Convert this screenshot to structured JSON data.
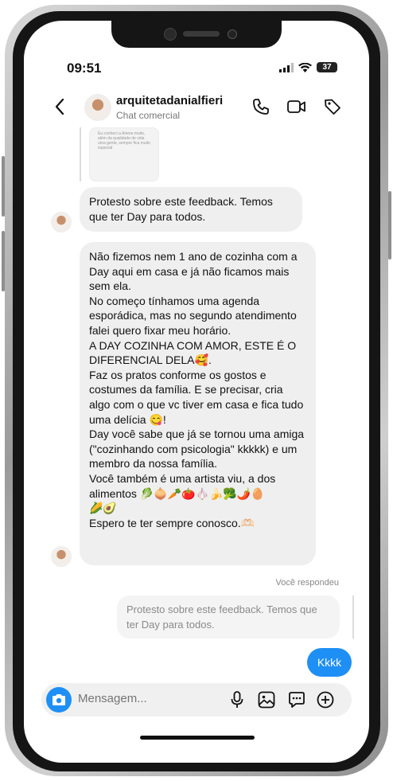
{
  "status": {
    "time": "09:51",
    "battery": "37"
  },
  "header": {
    "username": "arquitetadanialfieri",
    "subtitle": "Chat comercial"
  },
  "quoted_thumb_text": "Eu conheci a Ariene muito, além da qualidade de vida uma gente, sempre fica muito especial",
  "messages": [
    {
      "text": "Protesto sobre este feedback. Temos que ter Day para todos."
    },
    {
      "text": "Não fizemos nem 1 ano de cozinha com a Day aqui em casa e já não ficamos mais sem ela.\nNo começo tínhamos uma agenda esporádica, mas no segundo atendimento falei quero fixar meu horário.\nA DAY COZINHA COM AMOR, ESTE É O DIFERENCIAL DELA🥰.\nFaz os pratos conforme os gostos e costumes da família. E se precisar, cria algo com o que vc tiver em casa e fica tudo uma delícia 😋!\nDay você sabe que já se tornou uma amiga (\"cozinhando com psicologia\" kkkkk) e um membro da nossa família.\nVocê também é uma artista viu, a dos alimentos 🥬🧅🥕🍅🧄🍌🥦🌶️🥚\n🌽🥑\nEspero te ter sempre conosco.🫶🏻"
    }
  ],
  "replied_label": "Você respondeu",
  "reply_quote": "Protesto sobre este feedback. Temos que ter Day para todos.",
  "own_message": "Kkkk",
  "composer": {
    "placeholder": "Mensagem..."
  },
  "colors": {
    "accent": "#1e8ff5",
    "bubble": "#efefef"
  },
  "icons": [
    "back-arrow-icon",
    "phone-icon",
    "video-icon",
    "tag-icon",
    "camera-icon",
    "microphone-icon",
    "gallery-icon",
    "sticker-icon",
    "plus-icon",
    "signal-icon",
    "wifi-icon",
    "battery-icon"
  ]
}
